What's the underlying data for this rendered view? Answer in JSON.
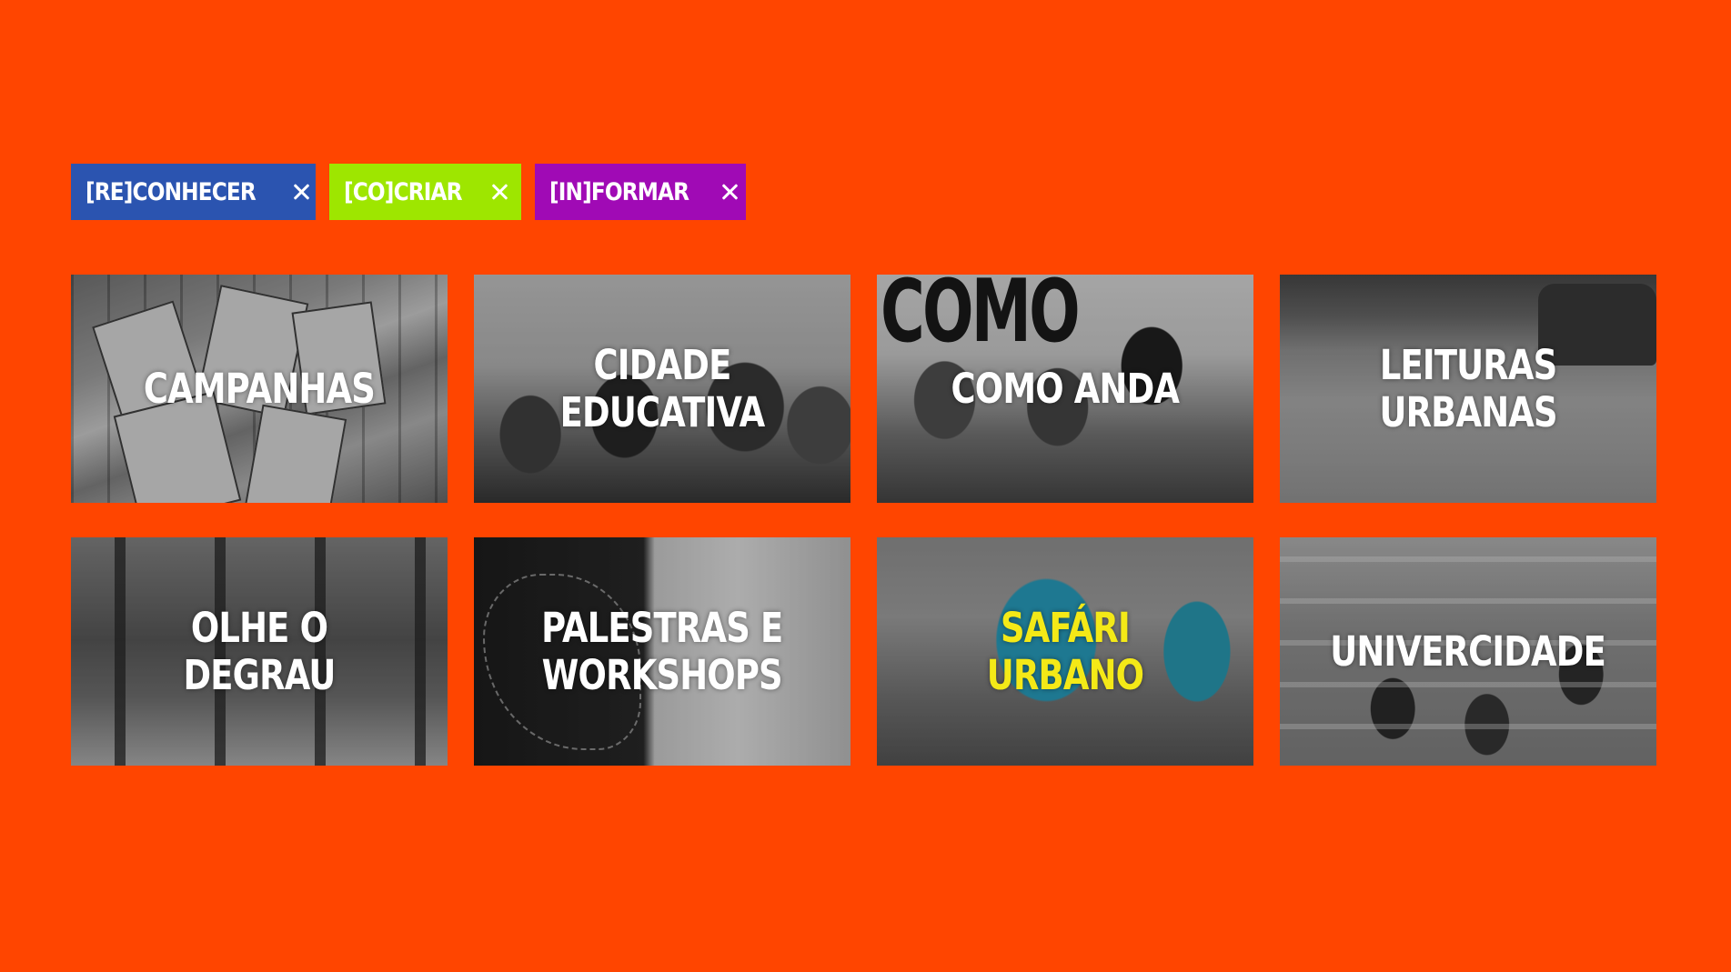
{
  "colors": {
    "background": "#FF4500",
    "tag_reconhecer": "#2B54B0",
    "tag_cocriar": "#9EE600",
    "tag_informar": "#A00AB5",
    "title_default": "#FFFFFF",
    "title_highlight": "#F4E917"
  },
  "filters": [
    {
      "label": "[RE]CONHECER",
      "icon": "close-icon"
    },
    {
      "label": "[CO]CRIAR",
      "icon": "close-icon"
    },
    {
      "label": "[IN]FORMAR",
      "icon": "close-icon"
    }
  ],
  "projects": [
    {
      "title": "CAMPANHAS"
    },
    {
      "title": "CIDADE\nEDUCATIVA"
    },
    {
      "title": "COMO ANDA",
      "photo_text": "COMO"
    },
    {
      "title": "LEITURAS\nURBANAS"
    },
    {
      "title": "OLHE O DEGRAU"
    },
    {
      "title": "PALESTRAS E\nWORKSHOPS"
    },
    {
      "title": "SAFÁRI URBANO"
    },
    {
      "title": "UNIVERCIDADE"
    }
  ]
}
